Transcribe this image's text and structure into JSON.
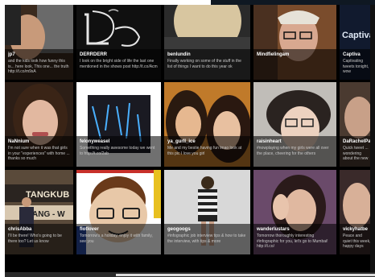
{
  "tiles": [
    {
      "username": "jp7",
      "tweet": "and the kids look how funny this is... here look, This one... the truth http://t.co/m9sA"
    },
    {
      "username": "DERRDERR",
      "tweet": "I look on the bright side of life the last one mentioned in the shows post http://t.co/Acm"
    },
    {
      "username": "benlundin",
      "tweet": "Finally working on some of the stuff in the list of things I want to do this year ok"
    },
    {
      "username": "Mindfielingam",
      "tweet": ""
    },
    {
      "username": "Captiva",
      "tweet": "Captivating tweets tonight, wow"
    },
    {
      "username": "NaNnium",
      "tweet": "I'm not sure when it was that girls in your \"experiences\" with home ... thanks so much"
    },
    {
      "username": "felonyweasel",
      "tweet": "Something really awesome today we went to http://t.co/2ab"
    },
    {
      "username": "ya_gurll_ice",
      "tweet": "Me and my bestie having fun lmao look at this pic I love you girl"
    },
    {
      "username": "raisinheart",
      "tweet": "#nowplaying when my girls were all over the place, cheering for the others"
    },
    {
      "username": "DaRachelPa",
      "tweet": "Quick tweet ... wondering about the new stuff"
    },
    {
      "username": "chrisAbba",
      "tweet": "I'll be there! Who's going to be there too? Let us know"
    },
    {
      "username": "flotlover",
      "tweet": "Tomorrow's a holiday, enjoy it with family, see you"
    },
    {
      "username": "geogoogs",
      "tweet": "#infographic job interview tips & how to take the interview, with tips & more"
    },
    {
      "username": "wanderlustars",
      "tweet": "Tomorrow thoroughly interesting #infographic for you, let's go to Mumbai! http://t.co/"
    },
    {
      "username": "vickyhatbe",
      "tweet": "Peace and quiet this week, happy days"
    }
  ],
  "colors": {
    "background": "#000000",
    "caption_overlay": "rgba(0,0,0,0.56)",
    "username": "#ffffff",
    "tweet": "#c8c8c8",
    "page": "#ffffff"
  }
}
